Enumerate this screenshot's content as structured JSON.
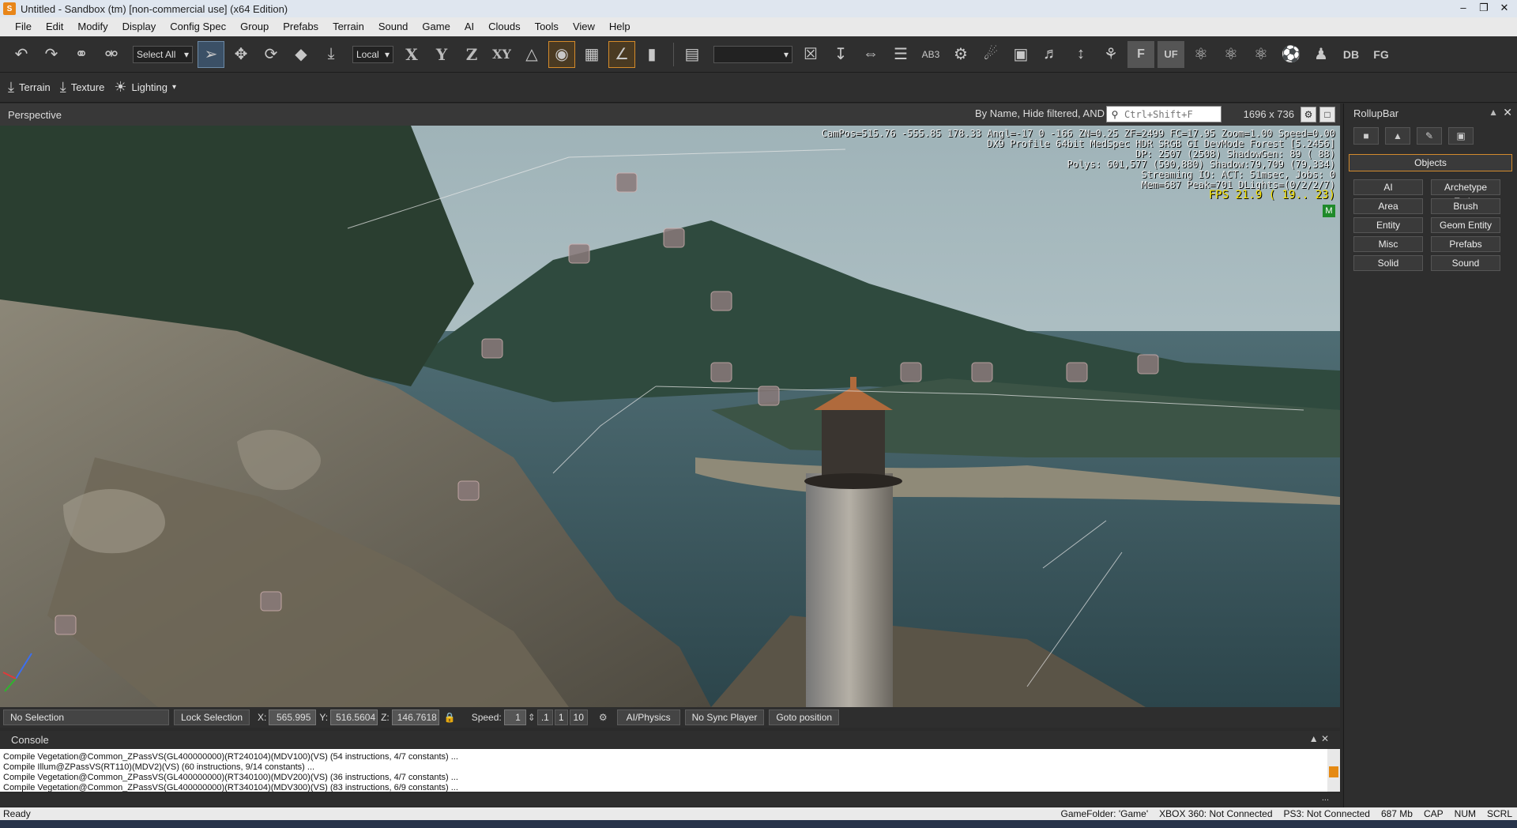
{
  "window": {
    "title": "Untitled - Sandbox (tm) [non-commercial use] (x64 Edition)"
  },
  "menu": [
    "File",
    "Edit",
    "Modify",
    "Display",
    "Config Spec",
    "Group",
    "Prefabs",
    "Terrain",
    "Sound",
    "Game",
    "AI",
    "Clouds",
    "Tools",
    "View",
    "Help"
  ],
  "toolbar": {
    "select_all": "Select All",
    "coord_system": "Local",
    "axis_x": "X",
    "axis_y": "Y",
    "axis_z": "Z",
    "axis_xy": "XY",
    "ab3": "AB3",
    "f_label": "F",
    "uf_label": "UF",
    "db_label": "DB",
    "fg_label": "FG"
  },
  "toolbar2": {
    "terrain": "Terrain",
    "texture": "Texture",
    "lighting": "Lighting"
  },
  "viewport": {
    "title": "Perspective",
    "filter_text": "By Name, Hide filtered, AND",
    "search_placeholder": "Ctrl+Shift+F",
    "resolution": "1696 x 736",
    "hud": [
      "CamPos=515.76 -555.85 178.33 Angl=-17  0 -166 ZN=0.25 ZF=2499 FC=17.95 Zoom=1.00 Speed=0.00",
      "DX9 Profile 64bit MedSpec HDR SRGB GI DevMode Forest [5.2456]",
      "DP: 2507 (2508) ShadowGen: 89 ( 88)",
      "Polys: 601,577 (590,880) Shadow:79,709 (79,334)",
      "Streaming IO: ACT:  51msec, Jobs: 0",
      "Mem=687 Peak=701 DLights=(0/2/2/7)"
    ],
    "fps": "FPS  21.9 ( 19.. 23)",
    "m_badge": "M"
  },
  "rollup": {
    "title": "RollupBar",
    "objects_label": "Objects",
    "buttons": [
      "AI",
      "Archetype Entity",
      "Area",
      "Brush",
      "Entity",
      "Geom Entity",
      "Misc",
      "Prefabs",
      "Solid",
      "Sound"
    ]
  },
  "vpstatus": {
    "selection": "No Selection",
    "lock": "Lock Selection",
    "x_label": "X:",
    "x_value": "565.995",
    "y_label": "Y:",
    "y_value": "516.5604",
    "z_label": "Z:",
    "z_value": "146.7618",
    "speed_label": "Speed:",
    "speed_value": "1",
    "speed_presets": [
      ".1",
      "1",
      "10"
    ],
    "ai_physics": "AI/Physics",
    "sync": "No Sync Player",
    "goto": "Goto position"
  },
  "console": {
    "title": "Console",
    "lines": [
      "Compile Vegetation@Common_ZPassVS(GL400000000)(RT240104)(MDV100)(VS) (54 instructions, 4/7 constants) ...",
      "Compile Illum@ZPassVS(RT110)(MDV2)(VS) (60 instructions, 9/14 constants) ...",
      "Compile Vegetation@Common_ZPassVS(GL400000000)(RT340100)(MDV200)(VS) (36 instructions, 4/7 constants) ...",
      "Compile Vegetation@Common_ZPassVS(GL400000000)(RT340104)(MDV300)(VS) (83 instructions, 6/9 constants) ..."
    ],
    "more": "..."
  },
  "status": {
    "ready": "Ready",
    "gamefolder": "GameFolder: 'Game'",
    "xbox": "XBOX 360: Not Connected",
    "ps3": "PS3: Not Connected",
    "mem": "687 Mb",
    "cap": "CAP",
    "num": "NUM",
    "scrl": "SCRL"
  }
}
